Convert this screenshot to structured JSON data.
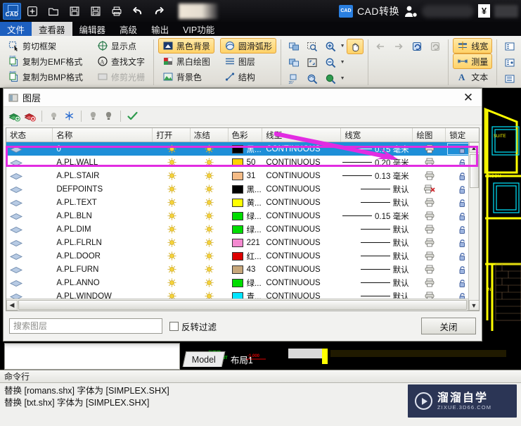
{
  "titlebar": {
    "logo": "CAD",
    "quick_actions": [
      "new-icon",
      "open-icon",
      "save-icon",
      "save-pdf-icon",
      "print-icon",
      "undo-icon",
      "redo-icon"
    ],
    "convert_label": "CAD转换",
    "currency_symbol": "¥"
  },
  "menu": {
    "tabs": [
      {
        "label": "文件",
        "state": "blue"
      },
      {
        "label": "查看器",
        "state": "active"
      },
      {
        "label": "编辑器",
        "state": "normal"
      },
      {
        "label": "高级",
        "state": "normal"
      },
      {
        "label": "输出",
        "state": "normal"
      },
      {
        "label": "VIP功能",
        "state": "normal"
      }
    ]
  },
  "ribbon": {
    "group1": [
      {
        "label": "剪切框架",
        "icon": "crop-frame-icon",
        "state": "normal"
      },
      {
        "label": "复制为EMF格式",
        "icon": "copy-emf-icon",
        "state": "normal"
      },
      {
        "label": "复制为BMP格式",
        "icon": "copy-bmp-icon",
        "state": "normal"
      }
    ],
    "group2": [
      {
        "label": "显示点",
        "icon": "show-points-icon",
        "state": "normal"
      },
      {
        "label": "查找文字",
        "icon": "find-text-icon",
        "state": "normal"
      },
      {
        "label": "修剪光栅",
        "icon": "trim-raster-icon",
        "state": "disabled"
      }
    ],
    "group3": [
      {
        "label": "黑色背景",
        "icon": "black-background-icon",
        "state": "highlighted"
      },
      {
        "label": "黑白绘图",
        "icon": "bw-drawing-icon",
        "state": "normal"
      },
      {
        "label": "背景色",
        "icon": "background-color-icon",
        "state": "normal"
      }
    ],
    "group4": [
      {
        "label": "圆滑弧形",
        "icon": "smooth-arc-icon",
        "state": "highlighted"
      },
      {
        "label": "图层",
        "icon": "layers-icon",
        "state": "normal"
      },
      {
        "label": "结构",
        "icon": "structure-icon",
        "state": "normal"
      }
    ],
    "group5_icons": [
      {
        "name": "zoom-window-icon",
        "state": "normal"
      },
      {
        "name": "zoom-extents-select-icon",
        "state": "normal"
      },
      {
        "name": "zoom-in-icon",
        "state": "normal",
        "dropdown": true
      },
      {
        "name": "pan-hand-icon",
        "state": "highlighted"
      },
      {
        "name": "zoom-previous-icon",
        "state": "normal"
      },
      {
        "name": "zoom-extents-icon",
        "state": "normal"
      },
      {
        "name": "zoom-out-icon",
        "state": "normal",
        "dropdown": true
      },
      {
        "name": "rotate-35-icon",
        "state": "normal"
      },
      {
        "name": "zoom-realtime-icon",
        "state": "normal"
      },
      {
        "name": "zoom-globe-icon",
        "state": "normal",
        "dropdown": true
      }
    ],
    "group6_icons": [
      {
        "name": "arrow-left-icon",
        "state": "disabled"
      },
      {
        "name": "arrow-right-icon",
        "state": "disabled"
      },
      {
        "name": "refresh-icon",
        "state": "normal"
      },
      {
        "name": "regen-icon",
        "state": "disabled"
      }
    ],
    "group7": [
      {
        "label": "线宽",
        "icon": "lineweight-icon",
        "state": "highlighted"
      },
      {
        "label": "测量",
        "icon": "measure-icon",
        "state": "highlighted"
      },
      {
        "label": "文本",
        "icon": "text-icon",
        "state": "normal"
      }
    ],
    "group8_icons": [
      {
        "name": "layout-list-icon-1",
        "state": "normal"
      },
      {
        "name": "layout-list-icon-2",
        "state": "normal"
      },
      {
        "name": "layout-list-icon-3",
        "state": "normal"
      }
    ]
  },
  "dialog": {
    "title": "图层",
    "close_icon": "close-icon",
    "toolbar": [
      {
        "name": "new-layer-icon"
      },
      {
        "name": "delete-layer-icon"
      },
      {
        "name": "layer-off-icon"
      },
      {
        "name": "freeze-snowflake-icon"
      },
      {
        "name": "layer-gray-icon"
      },
      {
        "name": "layer-bulb-icon"
      },
      {
        "name": "apply-check-icon"
      }
    ],
    "headers": [
      "状态",
      "名称",
      "打开",
      "冻结",
      "色彩",
      "线型",
      "线宽",
      "绘图",
      "锁定"
    ],
    "rows": [
      {
        "name": "0",
        "on": true,
        "freeze": true,
        "color_hex": "#000000",
        "color_name": "黑...",
        "linetype": "CONTINUOUS",
        "lineweight": "0.15 毫米",
        "plot": true,
        "locked": false,
        "selected": true
      },
      {
        "name": "A.PL.WALL",
        "on": true,
        "freeze": true,
        "color_hex": "#ffd400",
        "color_name": "50",
        "linetype": "CONTINUOUS",
        "lineweight": "0.20 毫米",
        "plot": true,
        "locked": false,
        "selected": false
      },
      {
        "name": "A.PL.STAIR",
        "on": true,
        "freeze": true,
        "color_hex": "#f5bc87",
        "color_name": "31",
        "linetype": "CONTINUOUS",
        "lineweight": "0.13 毫米",
        "plot": true,
        "locked": false,
        "selected": false
      },
      {
        "name": "DEFPOINTS",
        "on": true,
        "freeze": true,
        "color_hex": "#000000",
        "color_name": "黑...",
        "linetype": "CONTINUOUS",
        "lineweight": "默认",
        "plot": false,
        "locked": false,
        "selected": false
      },
      {
        "name": "A.PL.TEXT",
        "on": true,
        "freeze": true,
        "color_hex": "#ffff00",
        "color_name": "黄...",
        "linetype": "CONTINUOUS",
        "lineweight": "默认",
        "plot": true,
        "locked": false,
        "selected": false
      },
      {
        "name": "A.PL.BLN",
        "on": true,
        "freeze": true,
        "color_hex": "#00dd00",
        "color_name": "绿...",
        "linetype": "CONTINUOUS",
        "lineweight": "0.15 毫米",
        "plot": true,
        "locked": false,
        "selected": false
      },
      {
        "name": "A.PL.DIM",
        "on": true,
        "freeze": true,
        "color_hex": "#00dd00",
        "color_name": "绿...",
        "linetype": "CONTINUOUS",
        "lineweight": "默认",
        "plot": true,
        "locked": false,
        "selected": false
      },
      {
        "name": "A.PL.FLRLN",
        "on": true,
        "freeze": true,
        "color_hex": "#f48ad0",
        "color_name": "221",
        "linetype": "CONTINUOUS",
        "lineweight": "默认",
        "plot": true,
        "locked": false,
        "selected": false
      },
      {
        "name": "A.PL.DOOR",
        "on": true,
        "freeze": true,
        "color_hex": "#dd0000",
        "color_name": "红...",
        "linetype": "CONTINUOUS",
        "lineweight": "默认",
        "plot": true,
        "locked": false,
        "selected": false
      },
      {
        "name": "A.PL.FURN",
        "on": true,
        "freeze": true,
        "color_hex": "#c7a77b",
        "color_name": "43",
        "linetype": "CONTINUOUS",
        "lineweight": "默认",
        "plot": true,
        "locked": false,
        "selected": false
      },
      {
        "name": "A.PL.ANNO",
        "on": true,
        "freeze": true,
        "color_hex": "#00dd00",
        "color_name": "绿...",
        "linetype": "CONTINUOUS",
        "lineweight": "默认",
        "plot": true,
        "locked": false,
        "selected": false
      },
      {
        "name": "A.PL.WINDOW",
        "on": true,
        "freeze": true,
        "color_hex": "#00e5ff",
        "color_name": "青...",
        "linetype": "CONTINUOUS",
        "lineweight": "默认",
        "plot": true,
        "locked": false,
        "selected": false
      }
    ],
    "search_placeholder": "搜索图层",
    "filter_label": "反转过滤",
    "filter_checked": false,
    "close_label": "关闭"
  },
  "layout_tabs": [
    {
      "label": "Model",
      "active": true
    },
    {
      "label": "布局1",
      "active": false
    }
  ],
  "command": {
    "header": "命令行",
    "lines": [
      "替换 [romans.shx] 字体为 [SIMPLEX.SHX]",
      "替换 [txt.shx] 字体为 [SIMPLEX.SHX]"
    ]
  },
  "watermark": {
    "title": "溜溜自学",
    "subtitle": "ZIXUE.3D66.COM"
  },
  "annotation": {
    "color": "#e22ce2",
    "shapes": [
      "highlight-rectangle",
      "pointer-arrow"
    ]
  },
  "drawing": {
    "labels": [
      "BASEMENT",
      "地下层",
      "-1.000",
      "SUITE",
      "ROOM",
      "INT'D"
    ],
    "wall_color": "#ffff00",
    "detail_color": "#00e5ff",
    "text_color": "#00dd00"
  }
}
